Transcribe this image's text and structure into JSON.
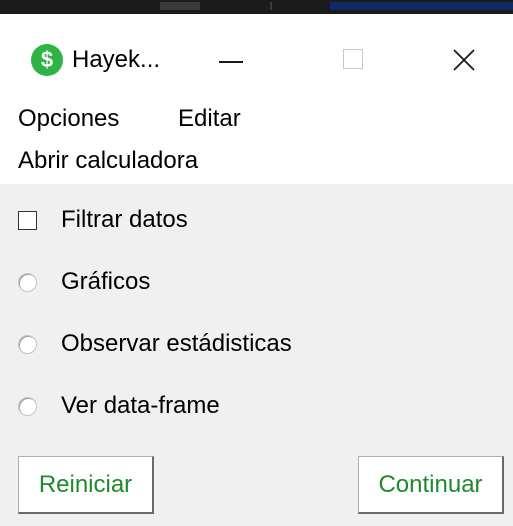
{
  "window": {
    "title": "Hayek...",
    "app_icon": "dollar-icon",
    "app_icon_glyph": "$",
    "controls": [
      "minimize-icon",
      "maximize-icon",
      "close-icon"
    ]
  },
  "menu": {
    "items": [
      {
        "label": "Opciones"
      },
      {
        "label": "Editar"
      }
    ],
    "second_row": {
      "label": "Abrir calculadora"
    }
  },
  "form": {
    "filter": {
      "label": "Filtrar datos",
      "checked": false
    },
    "options": [
      {
        "label": "Gráficos",
        "selected": false
      },
      {
        "label": "Observar estádisticas",
        "selected": false
      },
      {
        "label": "Ver data-frame",
        "selected": false
      }
    ]
  },
  "buttons": {
    "reset": "Reiniciar",
    "continue": "Continuar"
  },
  "colors": {
    "app_icon": "#2fb344",
    "button_text": "#1d8a2b",
    "client_bg": "#f0f0f0"
  }
}
